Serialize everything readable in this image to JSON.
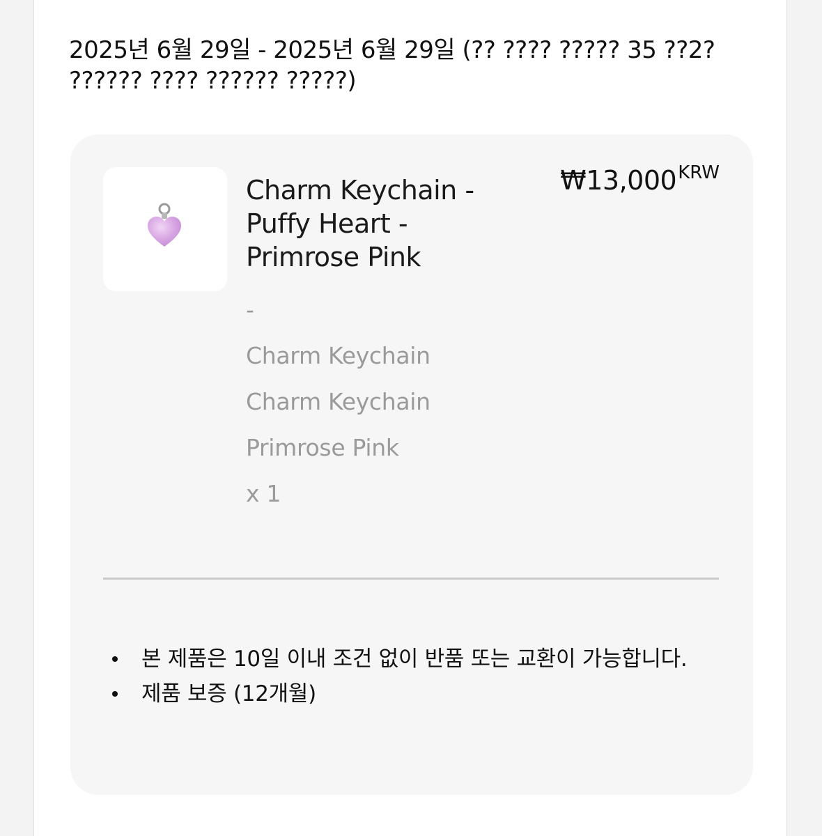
{
  "order": {
    "date_range": "2025년 6월 29일 - 2025년 6월 29일 (?? ???? ????? 35 ??2? ?????? ???? ?????? ?????)"
  },
  "item": {
    "title": "Charm Keychain - Puffy Heart - Primrose Pink",
    "price": "₩13,000",
    "currency": "KRW",
    "variant_separator": "-",
    "meta_line_1": "Charm Keychain",
    "meta_line_2": "Charm Keychain",
    "meta_line_3": "Primrose Pink",
    "quantity": "x 1",
    "thumbnail": {
      "icon": "heart-charm-icon",
      "color": "#d9a8e4"
    }
  },
  "notes": [
    "본 제품은 10일 이내 조건 없이 반품 또는 교환이 가능합니다.",
    "제품 보증 (12개월)"
  ],
  "colors": {
    "card_bg": "#f6f6f6",
    "meta_text": "#9a9a9a",
    "divider": "#c9c9c9"
  }
}
